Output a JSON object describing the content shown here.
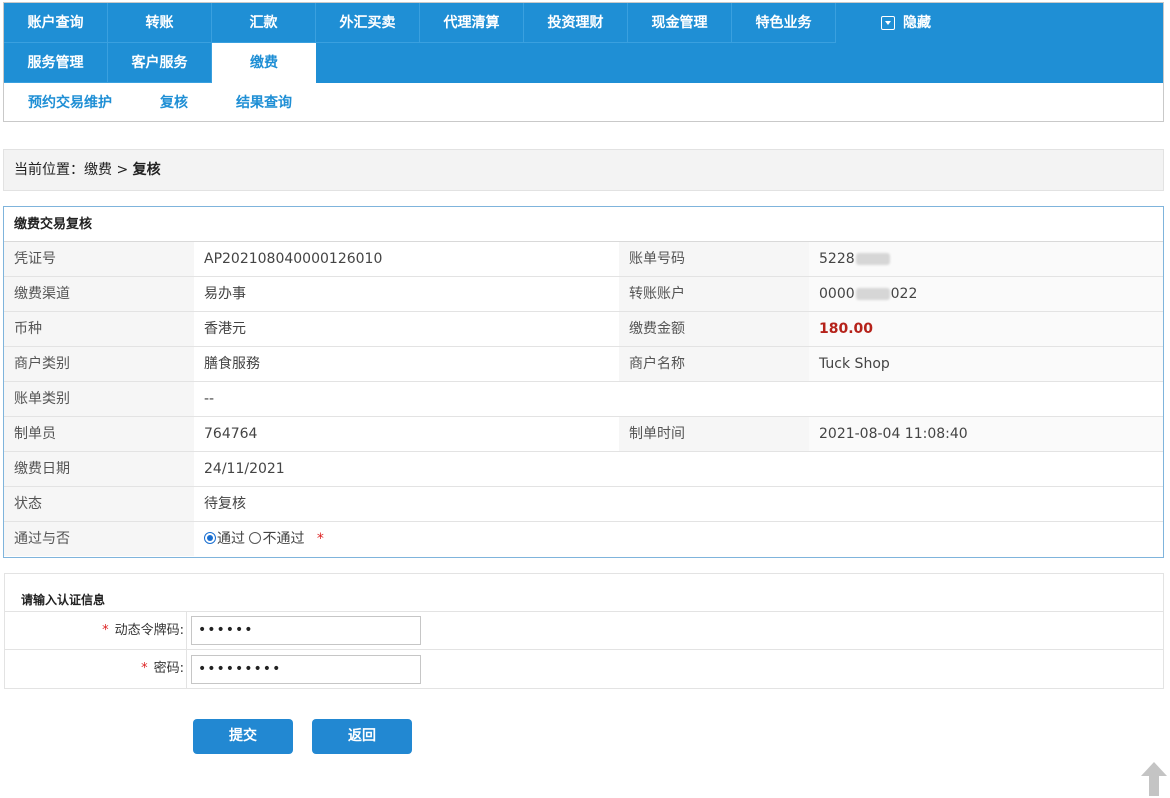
{
  "nav": {
    "row1": [
      "账户查询",
      "转账",
      "汇款",
      "外汇买卖",
      "代理清算",
      "投资理财",
      "现金管理",
      "特色业务"
    ],
    "hide_label": "隐藏",
    "row2": [
      "服务管理",
      "客户服务",
      "缴费"
    ],
    "active_tab": "缴费",
    "subnav": [
      "预约交易维护",
      "复核",
      "结果查询"
    ]
  },
  "breadcrumb": {
    "prefix": "当前位置：",
    "path": "缴费 > ",
    "current": "复核"
  },
  "review": {
    "title": "缴费交易复核",
    "voucher_label": "凭证号",
    "voucher_value": "AP202108040000126010",
    "bill_no_label": "账单号码",
    "bill_no_prefix": "5228",
    "channel_label": "缴费渠道",
    "channel_value": "易办事",
    "account_label": "转账账户",
    "account_prefix": "0000",
    "account_suffix": "022",
    "currency_label": "币种",
    "currency_value": "香港元",
    "amount_label": "缴费金额",
    "amount_value": "180.00",
    "merchant_type_label": "商户类别",
    "merchant_type_value": "膳食服務",
    "merchant_name_label": "商户名称",
    "merchant_name_value": "Tuck Shop",
    "bill_type_label": "账单类别",
    "bill_type_value": "--",
    "maker_label": "制单员",
    "maker_value": "764764",
    "make_time_label": "制单时间",
    "make_time_value": "2021-08-04 11:08:40",
    "pay_date_label": "缴费日期",
    "pay_date_value": "24/11/2021",
    "status_label": "状态",
    "status_value": "待复核",
    "approve_label": "通过与否",
    "approve_yes": "通过",
    "approve_no": "不通过",
    "required_mark": "*"
  },
  "auth": {
    "title": "请输入认证信息",
    "required_mark": "*",
    "token_label": "动态令牌码:",
    "token_value": "••••••",
    "password_label": "密码:",
    "password_value": "•••••••••"
  },
  "buttons": {
    "submit": "提交",
    "back": "返回"
  },
  "colors": {
    "nav_blue": "#1f8fd5",
    "amount_red": "#b5221a",
    "button_blue": "#2288d2"
  }
}
